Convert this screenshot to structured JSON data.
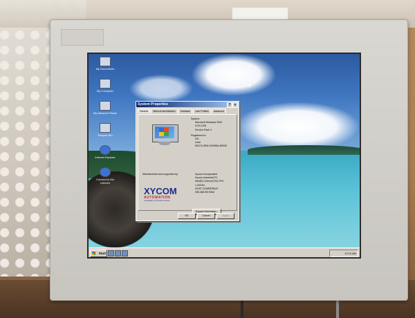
{
  "desktop": {
    "icons": [
      {
        "label": "My Documents",
        "icon": "folder-icon"
      },
      {
        "label": "My Computer",
        "icon": "computer-icon"
      },
      {
        "label": "My Network Places",
        "icon": "network-icon"
      },
      {
        "label": "Recycle Bin",
        "icon": "recycle-bin-icon"
      },
      {
        "label": "Internet Explorer",
        "icon": "ie-icon"
      },
      {
        "label": "Connect to the Internet",
        "icon": "connect-icon"
      }
    ]
  },
  "dialog": {
    "title": "System Properties",
    "help_glyph": "?",
    "close_glyph": "×",
    "tabs": [
      "General",
      "Network Identification",
      "Hardware",
      "User Profiles",
      "Advanced"
    ],
    "system_label": "System:",
    "system_lines": [
      "Microsoft Windows 2000",
      "5.00.2195",
      "Service Pack 4"
    ],
    "registered_label": "Registered to:",
    "registered_lines": [
      "HO",
      "Xcell",
      "55373-OEM-0029564-89936"
    ],
    "manufacturer_label": "Manufactured and supported by:",
    "manufacturer_lines": [
      "Xycom Incorporated",
      "Xycom Industrial PC",
      "Intel(R) Celeron(TM) CPU",
      "1.20GHz",
      "AT/AT COMPATIBLE",
      "255,468 KB RAM"
    ],
    "logo_word": "XYCOM",
    "logo_sub": "AUTOMATION",
    "logo_tag": "a subsidiary of Pro-face America",
    "support_button": "Support Information...",
    "buttons": [
      "OK",
      "Cancel",
      "Apply"
    ]
  },
  "taskbar": {
    "start_label": "Start",
    "clock": "12:19 AM"
  },
  "colors": {
    "titlebar": "#0a246a",
    "xycom_blue": "#1f2b8c",
    "xycom_red": "#c0282d",
    "bezel": "#d2cfc9"
  }
}
